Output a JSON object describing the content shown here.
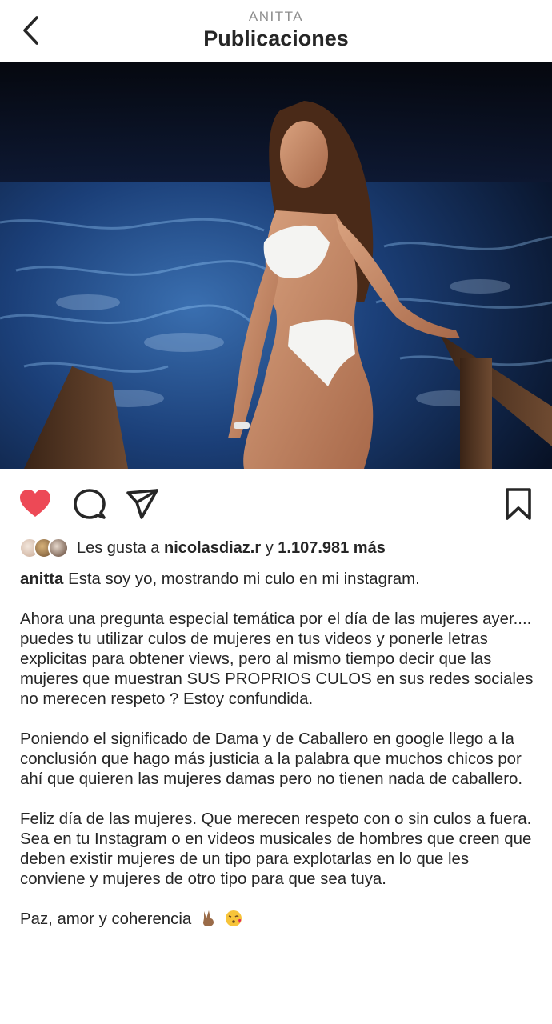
{
  "header": {
    "subtitle": "ANITTA",
    "title": "Publicaciones"
  },
  "post": {
    "image_icon": "photo-woman-white-bikini-night-water",
    "liked": true,
    "colors": {
      "heart": "#ed4956",
      "text": "#262626",
      "muted": "#8e8e8e"
    }
  },
  "actions": {
    "like_icon": "heart-icon",
    "comment_icon": "comment-icon",
    "share_icon": "send-icon",
    "save_icon": "bookmark-icon"
  },
  "likes": {
    "prefix": "Les gusta a",
    "user": "nicolasdiaz.r",
    "connector": "y",
    "count": "1.107.981 más"
  },
  "caption": {
    "username": "anitta",
    "p1": "Esta soy yo, mostrando mi culo en mi instagram.",
    "p2": "Ahora una pregunta especial temática por el día de las mujeres ayer.... puedes tu utilizar culos de mujeres en tus videos y ponerle letras explicitas para obtener views, pero al mismo tiempo decir que las mujeres que muestran SUS PROPRIOS CULOS en sus redes sociales no merecen respeto ? Estoy confundida.",
    "p3": "Poniendo el significado de Dama y de Caballero en google llego a la conclusión que hago más justicia a la palabra que muchos chicos por ahí que quieren las mujeres damas pero no tienen nada de caballero.",
    "p4": "Feliz día de las mujeres. Que merecen respeto con o sin culos a fuera. Sea en tu Instagram o en videos musicales de hombres que creen que deben existir mujeres de un tipo para explotarlas en lo que les conviene y mujeres de otro tipo para que sea tuya.",
    "p5": "Paz, amor y coherencia",
    "p5_emojis": [
      "victory-hand-emoji",
      "kissing-face-emoji"
    ]
  }
}
